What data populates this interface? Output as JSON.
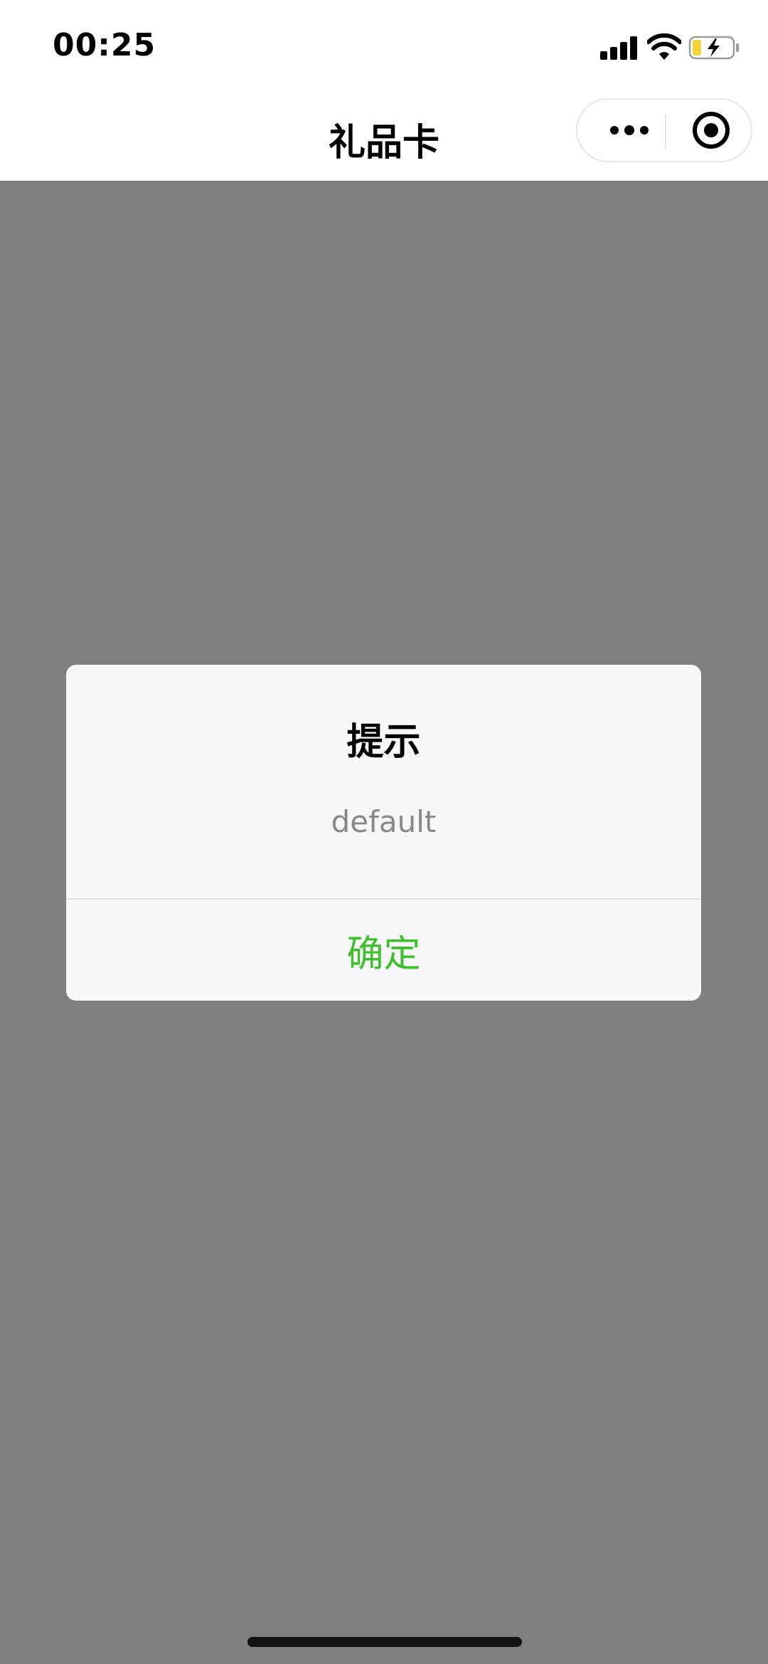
{
  "status_bar": {
    "time": "00:25",
    "icons": [
      "signal-icon",
      "wifi-icon",
      "battery-charging-icon"
    ],
    "battery_color": "#f3d33a"
  },
  "nav": {
    "title": "礼品卡",
    "more_icon": "more-dots-icon",
    "close_icon": "target-circle-icon"
  },
  "dialog": {
    "title": "提示",
    "message": "default",
    "confirm_label": "确定",
    "confirm_color": "#3fbf2e"
  },
  "overlay_color": "#7f7f7f"
}
